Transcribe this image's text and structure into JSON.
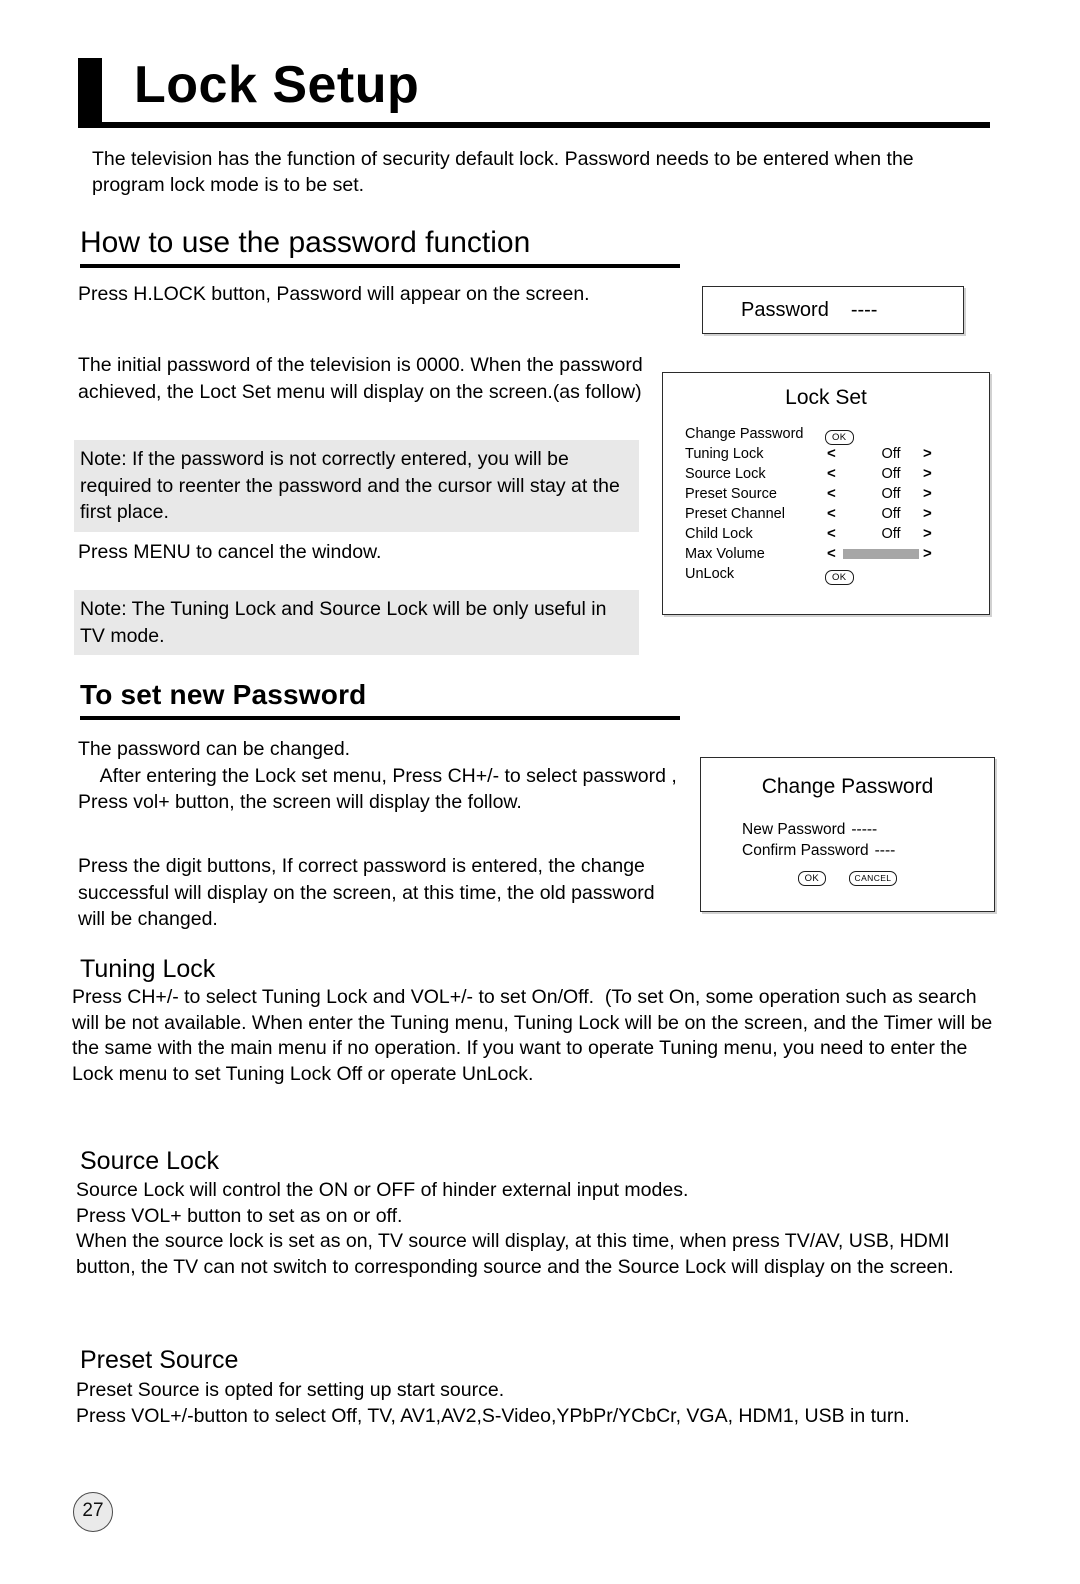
{
  "document": {
    "title": "Lock Setup",
    "page_number": "27",
    "intro": "The television has the function of security default lock. Password needs to be entered when the program lock mode is to be set."
  },
  "section_password": {
    "heading": "How to use the password function",
    "para_press_hlock": "Press H.LOCK button, Password will appear on the screen.",
    "para_initial": " The initial password of the television is 0000. When the password achieved, the Loct Set menu will display on the screen.(as follow)",
    "note_1": "Note: If the password is not correctly entered, you will be required to reenter the password and the cursor will stay at the first place.",
    "para_press_menu": "Press MENU to cancel the window.",
    "note_2": "Note: The Tuning Lock and Source Lock will be only useful in TV mode."
  },
  "osd_password": {
    "label": "Password",
    "value": "----"
  },
  "osd_lock_set": {
    "title": "Lock Set",
    "rows": [
      {
        "label": "Change Password",
        "control": "ok",
        "value": "OK"
      },
      {
        "label": "Tuning Lock",
        "control": "arrows",
        "value": "Off"
      },
      {
        "label": "Source Lock",
        "control": "arrows",
        "value": "Off"
      },
      {
        "label": "Preset Source",
        "control": "arrows",
        "value": "Off"
      },
      {
        "label": "Preset Channel",
        "control": "arrows",
        "value": "Off"
      },
      {
        "label": "Child Lock",
        "control": "arrows",
        "value": "Off"
      },
      {
        "label": "Max Volume",
        "control": "slider",
        "value": ""
      },
      {
        "label": "UnLock",
        "control": "ok",
        "value": "OK"
      }
    ],
    "left_arrow": "<",
    "right_arrow": ">"
  },
  "section_new_password": {
    "heading": "To set new Password",
    "para_can_be_changed": "The password can be changed.\n    After entering the Lock set menu, Press CH+/- to select password , Press vol+ button, the screen will display the follow.",
    "para_digit": "Press the digit buttons, If correct password is entered, the change successful will display on the screen, at this time, the old password will be changed."
  },
  "osd_change_password": {
    "title": "Change Password",
    "new_password_label": "New Password",
    "new_password_value": "-----",
    "confirm_password_label": "Confirm Password",
    "confirm_password_value": "----",
    "ok_label": "OK",
    "cancel_label": "CANCEL"
  },
  "section_tuning_lock": {
    "heading": "Tuning Lock",
    "body": "Press CH+/- to select Tuning Lock and VOL+/- to set On/Off.  (To set On, some operation such as search will be not available. When enter the Tuning menu, Tuning Lock will be on the screen, and the Timer will be the same with the main menu if no operation. If you want to operate Tuning menu, you need to enter the Lock menu to set Tuning Lock Off or operate UnLock."
  },
  "section_source_lock": {
    "heading": "Source Lock",
    "body": "Source Lock will control the ON or OFF of hinder external input modes.\nPress VOL+ button to set as on or off.\nWhen the source lock is set as on, TV source will display, at this time, when press TV/AV, USB, HDMI button, the TV can not switch to corresponding source and the Source Lock will display on the screen."
  },
  "section_preset_source": {
    "heading": "Preset Source",
    "body": "Preset Source is opted for setting up start source.\nPress VOL+/-button to select Off, TV, AV1,AV2,S-Video,YPbPr/YCbCr, VGA, HDM1, USB in turn."
  }
}
